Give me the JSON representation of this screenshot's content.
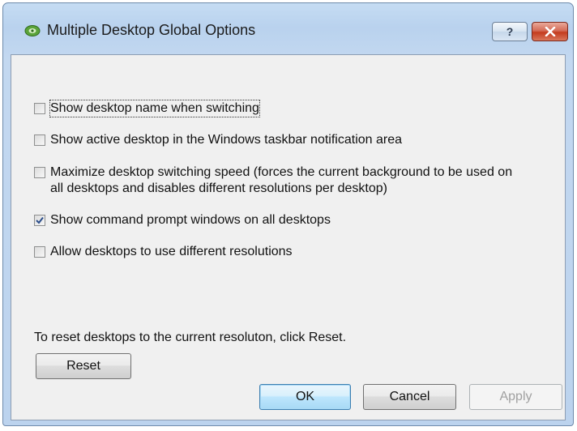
{
  "window": {
    "title": "Multiple Desktop Global Options",
    "help_label": "?",
    "close_label": "✕"
  },
  "options": [
    {
      "label": "Show desktop name when switching",
      "checked": false
    },
    {
      "label": "Show active desktop in the Windows taskbar notification area",
      "checked": false
    },
    {
      "label": "Maximize desktop switching speed (forces the current background to be used on",
      "label_line2": "all desktops and disables different resolutions per desktop)",
      "checked": false
    },
    {
      "label": "Show command prompt windows on all desktops",
      "checked": true
    },
    {
      "label": "Allow desktops to use different resolutions",
      "checked": false
    }
  ],
  "reset_text": "To reset desktops to the current resoluton, click Reset.",
  "buttons": {
    "reset": "Reset",
    "ok": "OK",
    "cancel": "Cancel",
    "apply": "Apply"
  },
  "colors": {
    "frame": "#bcd3ee",
    "client": "#f0f0f0",
    "close_button": "#c43b1e",
    "check_mark": "#2b4d8a"
  }
}
